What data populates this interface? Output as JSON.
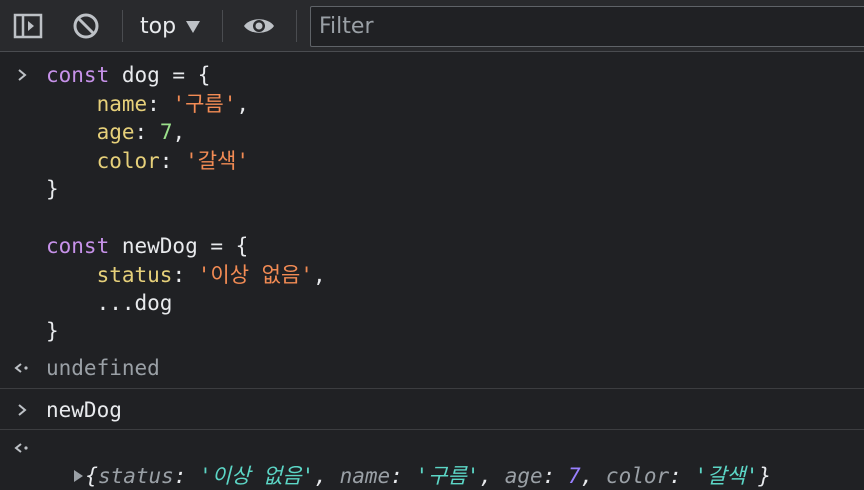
{
  "toolbar": {
    "context": "top",
    "filter_placeholder": "Filter"
  },
  "console": {
    "input1": {
      "l1": [
        "const",
        " dog = {"
      ],
      "l2": [
        "name",
        ": ",
        "'구름'",
        ","
      ],
      "l3": [
        "age",
        ": ",
        "7",
        ","
      ],
      "l4": [
        "color",
        ": ",
        "'갈색'"
      ],
      "l5": "}",
      "l7": [
        "const",
        " newDog = {"
      ],
      "l8": [
        "status",
        ": ",
        "'이상 없음'",
        ","
      ],
      "l9": "...dog",
      "l10": "}"
    },
    "result1": "undefined",
    "input2": "newDog",
    "result2": {
      "open": "{",
      "k1": "status",
      "v1": "'이상 없음'",
      "k2": "name",
      "v2": "'구름'",
      "k3": "age",
      "v3": "7",
      "k4": "color",
      "v4": "'갈색'",
      "close": "}"
    }
  }
}
